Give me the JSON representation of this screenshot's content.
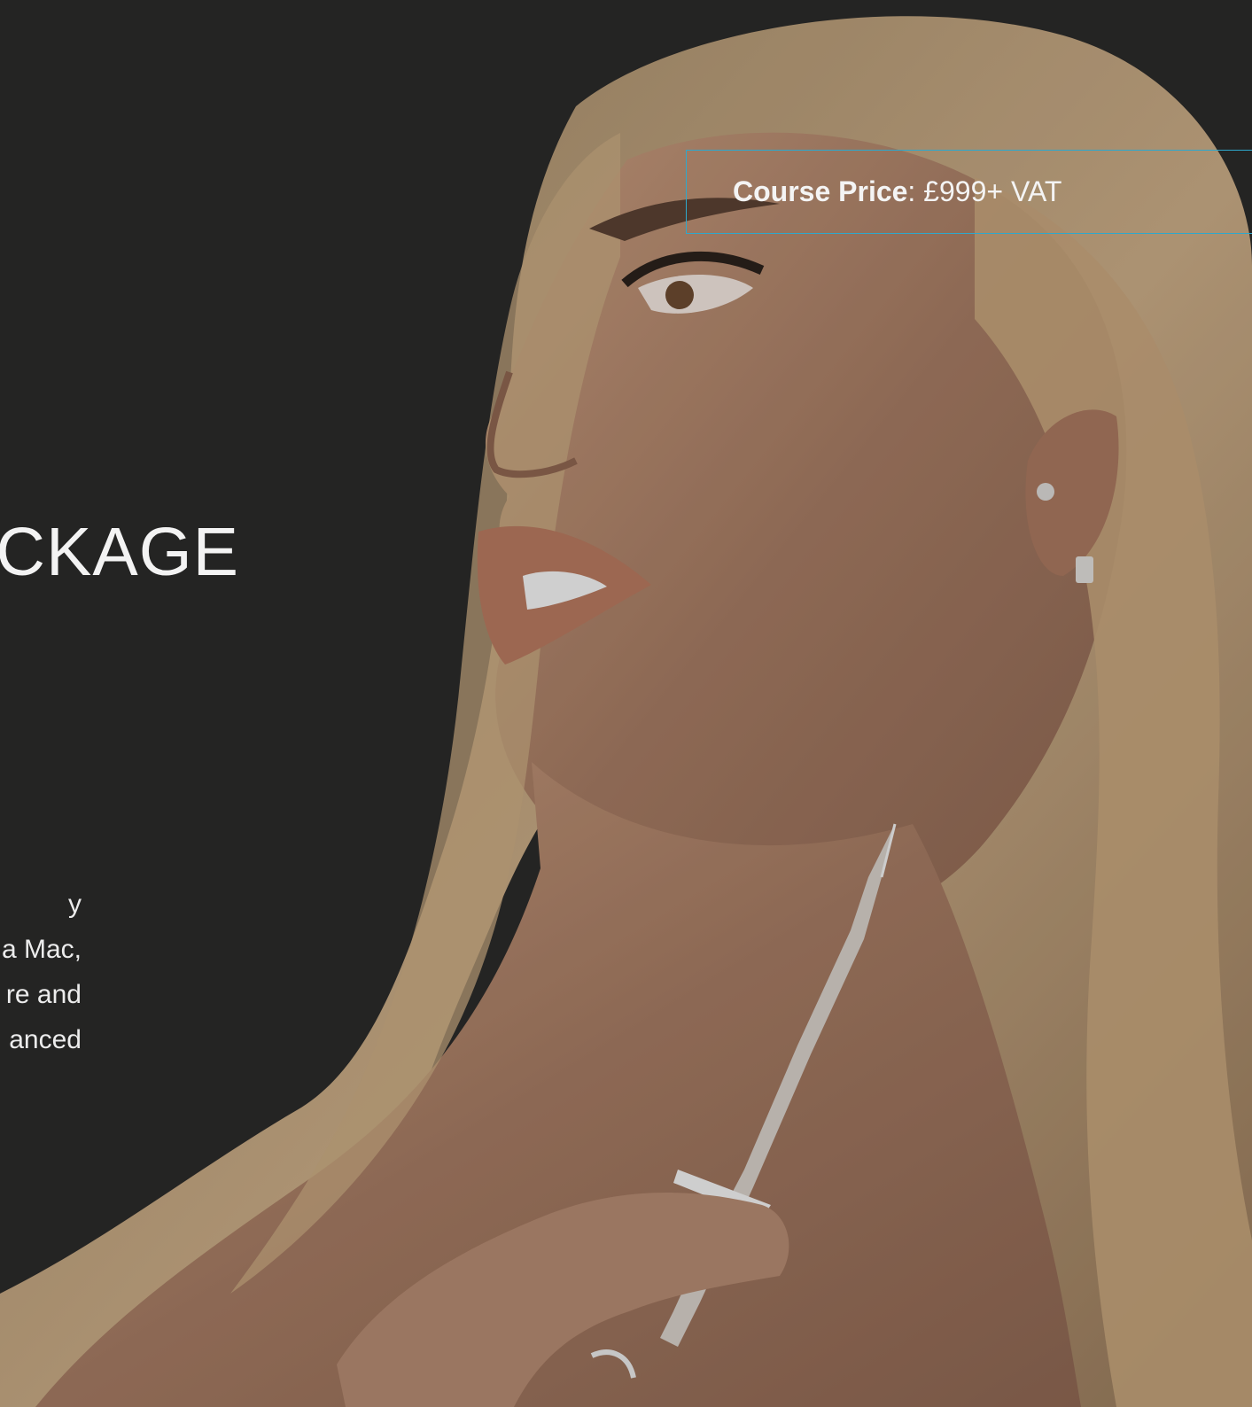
{
  "hero": {
    "title": "ACKAGE"
  },
  "description": {
    "lines": [
      "y",
      "a Mac,",
      "re and",
      "anced"
    ]
  },
  "price": {
    "label": "Course Price",
    "separator": ": ",
    "value": "£999+ VAT"
  },
  "colors": {
    "background": "#2b2a29",
    "accent_border": "#2ea8cc",
    "text": "#f4f4f4"
  },
  "image": {
    "icon": "portrait-photo"
  }
}
